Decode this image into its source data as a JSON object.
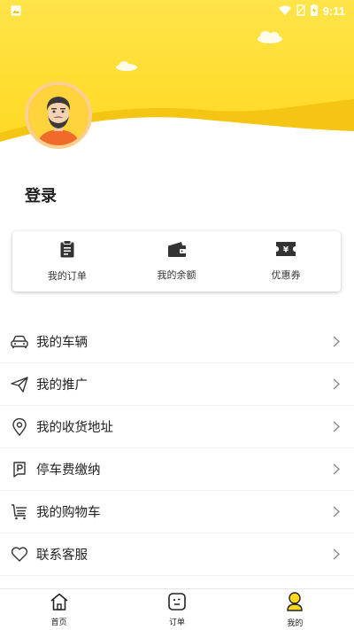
{
  "status": {
    "time": "9:11"
  },
  "profile": {
    "login_label": "登录"
  },
  "quick": [
    {
      "label": "我的订单",
      "icon": "clipboard-icon"
    },
    {
      "label": "我的余额",
      "icon": "wallet-icon"
    },
    {
      "label": "优惠券",
      "icon": "coupon-icon"
    }
  ],
  "menu": [
    {
      "label": "我的车辆",
      "icon": "car-icon"
    },
    {
      "label": "我的推广",
      "icon": "paper-plane-icon"
    },
    {
      "label": "我的收货地址",
      "icon": "location-pin-icon"
    },
    {
      "label": "停车费缴纳",
      "icon": "parking-icon"
    },
    {
      "label": "我的购物车",
      "icon": "shopping-cart-icon"
    },
    {
      "label": "联系客服",
      "icon": "heart-icon"
    }
  ],
  "bottom_nav": [
    {
      "label": "首页",
      "icon": "home-icon"
    },
    {
      "label": "订单",
      "icon": "order-icon"
    },
    {
      "label": "我的",
      "icon": "profile-icon",
      "active": true
    }
  ],
  "colors": {
    "accent": "#ffd81e",
    "accent_dark": "#f5c400"
  }
}
